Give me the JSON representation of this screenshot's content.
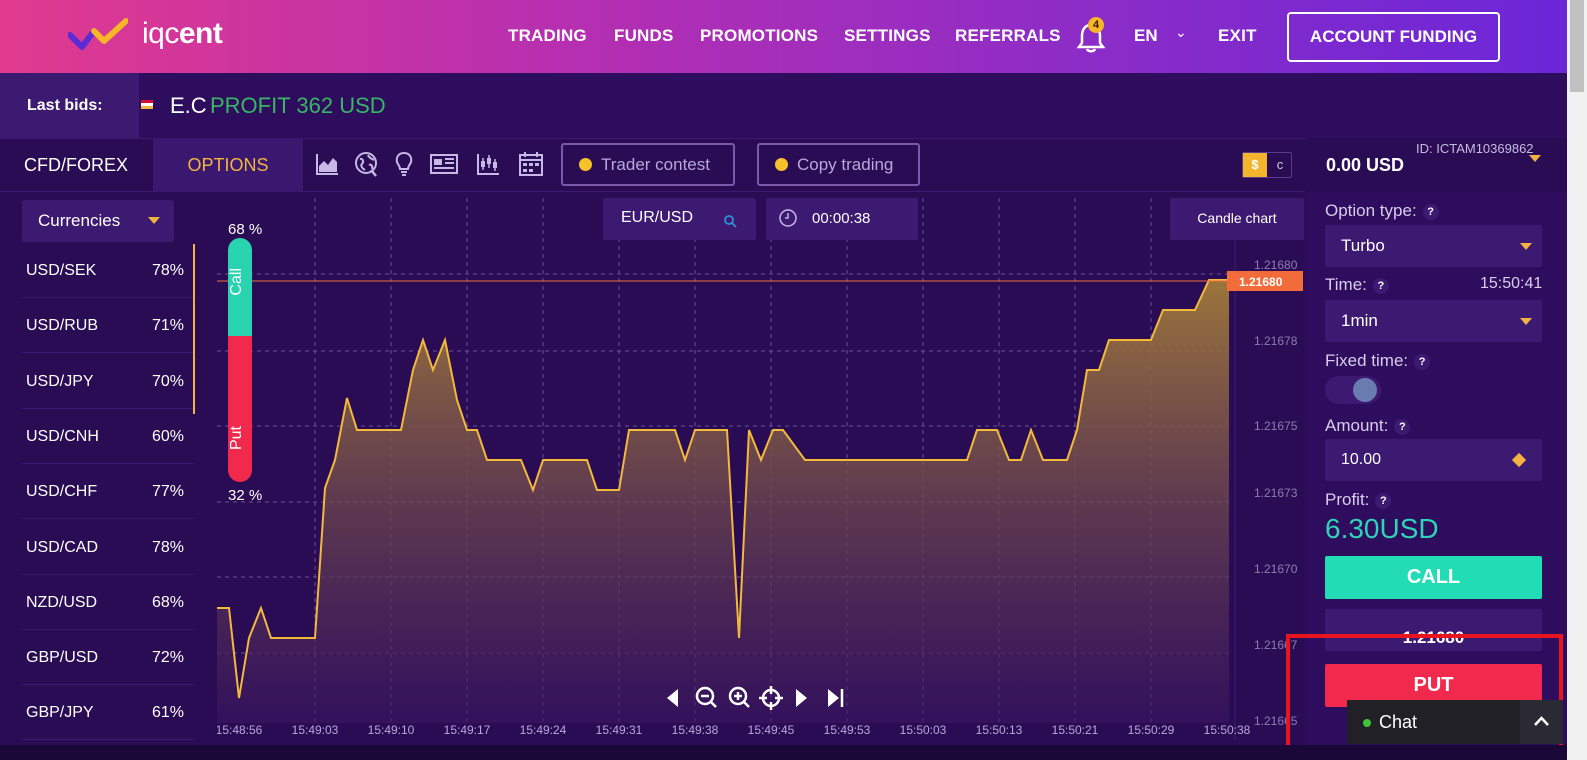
{
  "app": {
    "logo_text_light": "iqc",
    "logo_text_bold": "ent"
  },
  "nav": {
    "items": [
      "TRADING",
      "FUNDS",
      "PROMOTIONS",
      "SETTINGS",
      "REFERRALS"
    ],
    "notification_count": "4",
    "language": "EN",
    "exit": "EXIT",
    "account_funding": "ACCOUNT FUNDING"
  },
  "bids": {
    "label": "Last bids:",
    "name": "E.C",
    "profit": "PROFIT 362 USD"
  },
  "tabs": {
    "cfd": "CFD/FOREX",
    "options": "OPTIONS",
    "trader_contest": "Trader contest",
    "copy_trading": "Copy trading",
    "currency_dollar": "$",
    "currency_cent": "c"
  },
  "tool_icons": [
    "area-chart-icon",
    "globe-icon",
    "lightbulb-icon",
    "news-icon",
    "candles-icon",
    "calendar-icon"
  ],
  "currencies": {
    "select_label": "Currencies",
    "pairs": [
      {
        "name": "USD/SEK",
        "pct": "78%"
      },
      {
        "name": "USD/RUB",
        "pct": "71%"
      },
      {
        "name": "USD/JPY",
        "pct": "70%"
      },
      {
        "name": "USD/CNH",
        "pct": "60%"
      },
      {
        "name": "USD/CHF",
        "pct": "77%"
      },
      {
        "name": "USD/CAD",
        "pct": "78%"
      },
      {
        "name": "NZD/USD",
        "pct": "68%"
      },
      {
        "name": "GBP/USD",
        "pct": "72%"
      },
      {
        "name": "GBP/JPY",
        "pct": "61%"
      }
    ]
  },
  "chart": {
    "symbol": "EUR/USD",
    "timer": "00:00:38",
    "chart_type_btn": "Candle chart",
    "call_pct": "68 %",
    "put_pct": "32 %",
    "call_label": "Call",
    "put_label": "Put",
    "current_price": "1.21680",
    "y_ticks": [
      "1.21680",
      "1.21678",
      "1.21675",
      "1.21673",
      "1.21670",
      "1.21667",
      "1.21665"
    ],
    "x_ticks": [
      "15:48:56",
      "15:49:03",
      "15:49:10",
      "15:49:17",
      "15:49:24",
      "15:49:31",
      "15:49:38",
      "15:49:45",
      "15:49:53",
      "15:50:03",
      "15:50:13",
      "15:50:21",
      "15:50:29",
      "15:50:38"
    ],
    "colors": {
      "line": "#f2b93b",
      "price_line": "#f26b3a",
      "call": "#29d3b0",
      "put": "#f0294d"
    }
  },
  "right": {
    "account_id": "ID: ICTAM10369862",
    "balance": "0.00 USD",
    "option_type_label": "Option type:",
    "option_type": "Turbo",
    "time_label": "Time:",
    "time_value": "15:50:41",
    "duration": "1min",
    "fixed_time_label": "Fixed time:",
    "amount_label": "Amount:",
    "amount": "10.00",
    "profit_label": "Profit:",
    "profit": "6.30USD",
    "call": "CALL",
    "price": "1.21680",
    "put": "PUT",
    "q": "?"
  },
  "chat": {
    "label": "Chat"
  }
}
